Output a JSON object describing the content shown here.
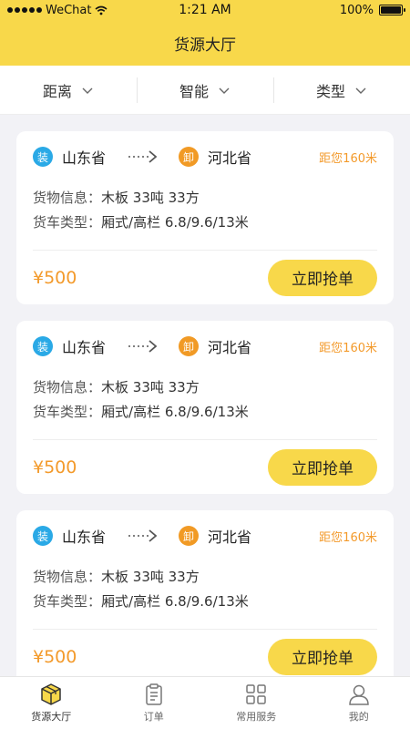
{
  "status_bar": {
    "carrier": "WeChat",
    "time": "1:21 AM",
    "battery": "100%",
    "battery_level": 1.0
  },
  "header": {
    "title": "货源大厅"
  },
  "filters": [
    {
      "label": "距离"
    },
    {
      "label": "智能"
    },
    {
      "label": "类型"
    }
  ],
  "cards": [
    {
      "load_tag": "装",
      "from": "山东省",
      "unload_tag": "卸",
      "to": "河北省",
      "distance": "距您160米",
      "goods_label": "货物信息：",
      "goods": "木板   33吨   33方",
      "truck_label": "货车类型：",
      "truck": "厢式/高栏   6.8/9.6/13米",
      "price": "¥500",
      "button": "立即抢单"
    },
    {
      "load_tag": "装",
      "from": "山东省",
      "unload_tag": "卸",
      "to": "河北省",
      "distance": "距您160米",
      "goods_label": "货物信息：",
      "goods": "木板   33吨   33方",
      "truck_label": "货车类型：",
      "truck": "厢式/高栏   6.8/9.6/13米",
      "price": "¥500",
      "button": "立即抢单"
    },
    {
      "load_tag": "装",
      "from": "山东省",
      "unload_tag": "卸",
      "to": "河北省",
      "distance": "距您160米",
      "goods_label": "货物信息：",
      "goods": "木板   33吨   33方",
      "truck_label": "货车类型：",
      "truck": "厢式/高栏   6.8/9.6/13米",
      "price": "¥500",
      "button": "立即抢单"
    }
  ],
  "tabbar": [
    {
      "label": "货源大厅",
      "icon": "box-icon",
      "active": true
    },
    {
      "label": "订单",
      "icon": "clipboard-icon",
      "active": false
    },
    {
      "label": "常用服务",
      "icon": "grid-icon",
      "active": false
    },
    {
      "label": "我的",
      "icon": "person-icon",
      "active": false
    }
  ],
  "colors": {
    "accent": "#f8d84a",
    "orange": "#f39a2b",
    "blue": "#2aa9e6"
  }
}
